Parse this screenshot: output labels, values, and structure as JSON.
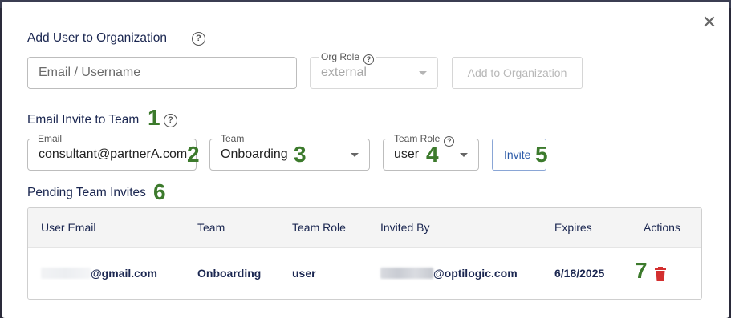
{
  "dialog": {
    "close_glyph": "✕"
  },
  "add_user": {
    "heading": "Add User to Organization",
    "email_placeholder": "Email / Username",
    "org_role_label": "Org Role",
    "org_role_value": "external",
    "add_button": "Add to Organization"
  },
  "email_invite": {
    "heading": "Email Invite to Team",
    "email_label": "Email",
    "email_value": "consultant@partnerA.com",
    "team_label": "Team",
    "team_value": "Onboarding",
    "team_role_label": "Team Role",
    "team_role_value": "user",
    "invite_button": "Invite"
  },
  "pending": {
    "heading": "Pending Team Invites",
    "columns": [
      "User Email",
      "Team",
      "Team Role",
      "Invited By",
      "Expires",
      "Actions"
    ],
    "rows": [
      {
        "user_email": "@gmail.com",
        "team": "Onboarding",
        "team_role": "user",
        "invited_by": "@optilogic.com",
        "expires": "6/18/2025"
      }
    ]
  },
  "annotations": [
    "1",
    "2",
    "3",
    "4",
    "5",
    "6",
    "7"
  ],
  "icons": {
    "help": "question-circle-icon",
    "dropdown": "caret-down-icon",
    "delete": "trash-icon",
    "close": "close-icon"
  },
  "colors": {
    "heading": "#1a2650",
    "annotation": "#3c7a2c",
    "delete": "#d32f2f",
    "invite": "#2b5aa8"
  }
}
